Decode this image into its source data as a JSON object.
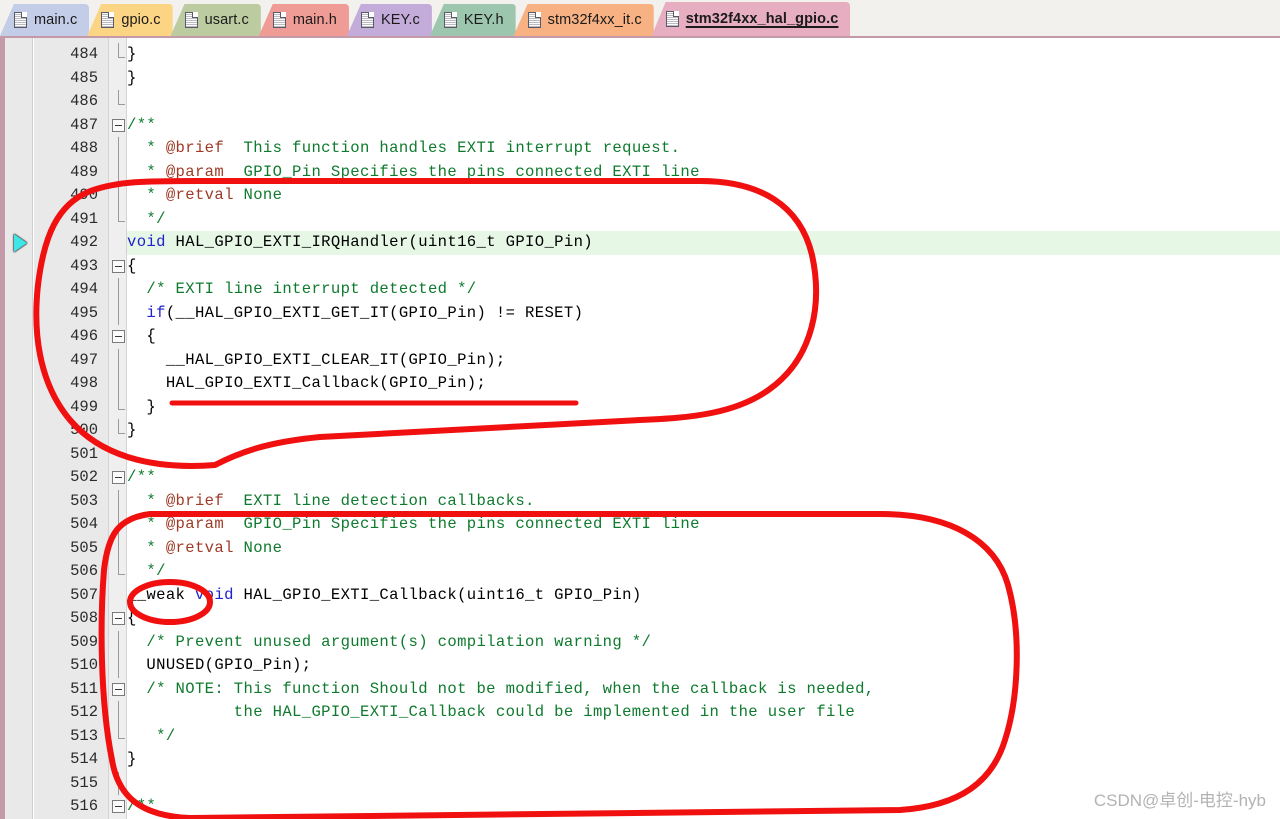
{
  "window": {
    "title": "stm32f4xx_hal_gpio.c",
    "accent_color": "#c49aa8",
    "watermark": "CSDN@卓创-电控-hyb"
  },
  "tabs": [
    {
      "label": "main.c",
      "icon": "file-icon",
      "color": "#c3cde7",
      "active": false
    },
    {
      "label": "gpio.c",
      "icon": "file-icon",
      "color": "#fbd584",
      "active": false
    },
    {
      "label": "usart.c",
      "icon": "file-icon",
      "color": "#bccba0",
      "active": false
    },
    {
      "label": "main.h",
      "icon": "file-icon",
      "color": "#ef9b96",
      "active": false
    },
    {
      "label": "KEY.c",
      "icon": "file-icon",
      "color": "#c3abda",
      "active": false
    },
    {
      "label": "KEY.h",
      "icon": "file-icon",
      "color": "#9dc6ae",
      "active": false
    },
    {
      "label": "stm32f4xx_it.c",
      "icon": "file-icon",
      "color": "#f7b183",
      "active": false
    },
    {
      "label": "stm32f4xx_hal_gpio.c",
      "icon": "file-icon",
      "color": "#e6aec0",
      "active": true
    }
  ],
  "editor": {
    "current_line": 492,
    "current_line_color": "#e6f7e6",
    "first_line": 484,
    "last_line": 516,
    "lines": [
      {
        "n": 484,
        "indent": 3,
        "fold": "bar-end",
        "tokens": [
          {
            "t": "pln",
            "s": "}"
          }
        ]
      },
      {
        "n": 485,
        "indent": 1,
        "fold": "none",
        "tokens": [
          {
            "t": "pln",
            "s": "}"
          }
        ]
      },
      {
        "n": 486,
        "indent": 0,
        "fold": "bar-end",
        "tokens": [
          {
            "t": "pln",
            "s": ""
          }
        ]
      },
      {
        "n": 487,
        "indent": 0,
        "fold": "box",
        "tokens": [
          {
            "t": "cmt",
            "s": "/**"
          }
        ]
      },
      {
        "n": 488,
        "indent": 0,
        "fold": "bar",
        "tokens": [
          {
            "t": "cmt",
            "s": "  * "
          },
          {
            "t": "tag",
            "s": "@brief"
          },
          {
            "t": "cmt",
            "s": "  This function handles EXTI interrupt request."
          }
        ]
      },
      {
        "n": 489,
        "indent": 0,
        "fold": "bar",
        "tokens": [
          {
            "t": "cmt",
            "s": "  * "
          },
          {
            "t": "tag",
            "s": "@param"
          },
          {
            "t": "cmt",
            "s": "  GPIO_Pin Specifies the pins connected EXTI line"
          }
        ]
      },
      {
        "n": 490,
        "indent": 0,
        "fold": "bar",
        "tokens": [
          {
            "t": "cmt",
            "s": "  * "
          },
          {
            "t": "tag",
            "s": "@retval"
          },
          {
            "t": "cmt",
            "s": " None"
          }
        ]
      },
      {
        "n": 491,
        "indent": 0,
        "fold": "bar-end",
        "tokens": [
          {
            "t": "cmt",
            "s": "  */"
          }
        ]
      },
      {
        "n": 492,
        "indent": 0,
        "fold": "none",
        "tokens": [
          {
            "t": "kw",
            "s": "void"
          },
          {
            "t": "pln",
            "s": " HAL_GPIO_EXTI_IRQHandler(uint16_t GPIO_Pin)"
          }
        ]
      },
      {
        "n": 493,
        "indent": 0,
        "fold": "box",
        "tokens": [
          {
            "t": "pln",
            "s": "{"
          }
        ]
      },
      {
        "n": 494,
        "indent": 0,
        "fold": "bar",
        "tokens": [
          {
            "t": "cmt",
            "s": "  /* EXTI line interrupt detected */"
          }
        ]
      },
      {
        "n": 495,
        "indent": 0,
        "fold": "bar",
        "tokens": [
          {
            "t": "pln",
            "s": "  "
          },
          {
            "t": "kw",
            "s": "if"
          },
          {
            "t": "pln",
            "s": "(__HAL_GPIO_EXTI_GET_IT(GPIO_Pin) != RESET)"
          }
        ]
      },
      {
        "n": 496,
        "indent": 0,
        "fold": "box",
        "tokens": [
          {
            "t": "pln",
            "s": "  {"
          }
        ]
      },
      {
        "n": 497,
        "indent": 0,
        "fold": "bar",
        "tokens": [
          {
            "t": "pln",
            "s": "    __HAL_GPIO_EXTI_CLEAR_IT(GPIO_Pin);"
          }
        ]
      },
      {
        "n": 498,
        "indent": 0,
        "fold": "bar",
        "tokens": [
          {
            "t": "pln",
            "s": "    HAL_GPIO_EXTI_Callback(GPIO_Pin);"
          }
        ]
      },
      {
        "n": 499,
        "indent": 0,
        "fold": "bar-end",
        "tokens": [
          {
            "t": "pln",
            "s": "  }"
          }
        ]
      },
      {
        "n": 500,
        "indent": 0,
        "fold": "bar-end",
        "tokens": [
          {
            "t": "pln",
            "s": "}"
          }
        ]
      },
      {
        "n": 501,
        "indent": 0,
        "fold": "none",
        "tokens": [
          {
            "t": "pln",
            "s": ""
          }
        ]
      },
      {
        "n": 502,
        "indent": 0,
        "fold": "box",
        "tokens": [
          {
            "t": "cmt",
            "s": "/**"
          }
        ]
      },
      {
        "n": 503,
        "indent": 0,
        "fold": "bar",
        "tokens": [
          {
            "t": "cmt",
            "s": "  * "
          },
          {
            "t": "tag",
            "s": "@brief"
          },
          {
            "t": "cmt",
            "s": "  EXTI line detection callbacks."
          }
        ]
      },
      {
        "n": 504,
        "indent": 0,
        "fold": "bar",
        "tokens": [
          {
            "t": "cmt",
            "s": "  * "
          },
          {
            "t": "tag",
            "s": "@param"
          },
          {
            "t": "cmt",
            "s": "  GPIO_Pin Specifies the pins connected EXTI line"
          }
        ]
      },
      {
        "n": 505,
        "indent": 0,
        "fold": "bar",
        "tokens": [
          {
            "t": "cmt",
            "s": "  * "
          },
          {
            "t": "tag",
            "s": "@retval"
          },
          {
            "t": "cmt",
            "s": " None"
          }
        ]
      },
      {
        "n": 506,
        "indent": 0,
        "fold": "bar-end",
        "tokens": [
          {
            "t": "cmt",
            "s": "  */"
          }
        ]
      },
      {
        "n": 507,
        "indent": 0,
        "fold": "none",
        "tokens": [
          {
            "t": "pln",
            "s": "__weak "
          },
          {
            "t": "kw",
            "s": "void"
          },
          {
            "t": "pln",
            "s": " HAL_GPIO_EXTI_Callback(uint16_t GPIO_Pin)"
          }
        ]
      },
      {
        "n": 508,
        "indent": 0,
        "fold": "box",
        "tokens": [
          {
            "t": "pln",
            "s": "{"
          }
        ]
      },
      {
        "n": 509,
        "indent": 0,
        "fold": "bar",
        "tokens": [
          {
            "t": "cmt",
            "s": "  /* Prevent unused argument(s) compilation warning */"
          }
        ]
      },
      {
        "n": 510,
        "indent": 0,
        "fold": "bar",
        "tokens": [
          {
            "t": "pln",
            "s": "  UNUSED(GPIO_Pin);"
          }
        ]
      },
      {
        "n": 511,
        "indent": 0,
        "fold": "box",
        "tokens": [
          {
            "t": "cmt",
            "s": "  /* NOTE: This function Should not be modified, when the callback is needed,"
          }
        ]
      },
      {
        "n": 512,
        "indent": 0,
        "fold": "bar",
        "tokens": [
          {
            "t": "cmt",
            "s": "           the HAL_GPIO_EXTI_Callback could be implemented in the user file"
          }
        ]
      },
      {
        "n": 513,
        "indent": 0,
        "fold": "bar-end",
        "tokens": [
          {
            "t": "cmt",
            "s": "   */"
          }
        ]
      },
      {
        "n": 514,
        "indent": 0,
        "fold": "none",
        "tokens": [
          {
            "t": "pln",
            "s": "}"
          }
        ]
      },
      {
        "n": 515,
        "indent": 0,
        "fold": "bar",
        "tokens": [
          {
            "t": "pln",
            "s": ""
          }
        ]
      },
      {
        "n": 516,
        "indent": 0,
        "fold": "box",
        "tokens": [
          {
            "t": "cmt",
            "s": "/**"
          }
        ]
      }
    ]
  },
  "annotations": {
    "color": "#f01010",
    "stroke": 6,
    "shapes": [
      {
        "name": "irqhandler-region-circle",
        "kind": "freehand-loop"
      },
      {
        "name": "callback-call-underline",
        "kind": "underline"
      },
      {
        "name": "weak-keyword-ellipse",
        "kind": "ellipse"
      },
      {
        "name": "callback-body-region-circle",
        "kind": "freehand-loop"
      }
    ]
  }
}
